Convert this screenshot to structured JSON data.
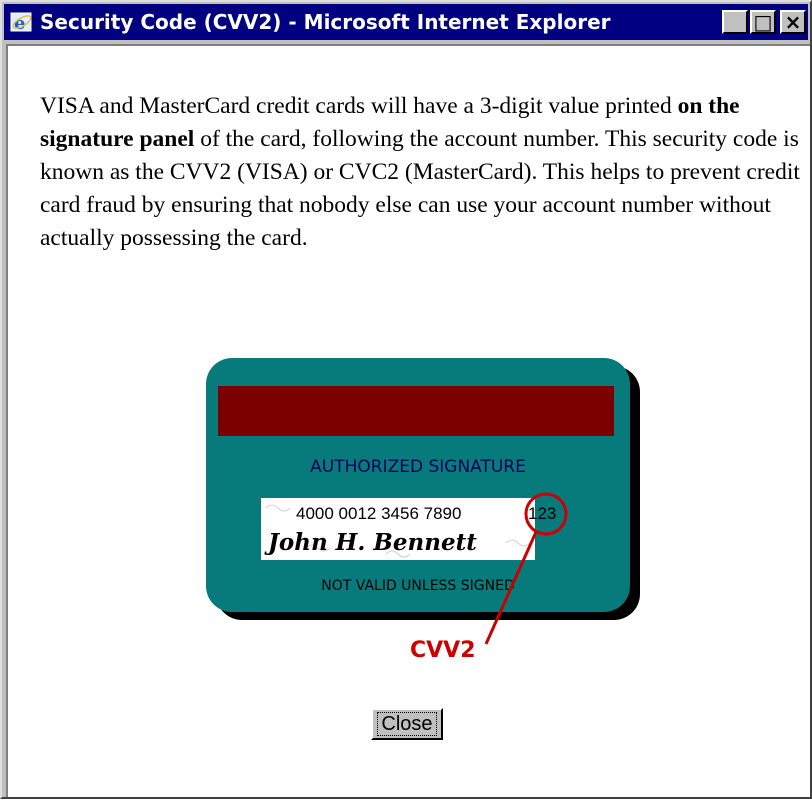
{
  "window": {
    "title": "Security Code (CVV2) - Microsoft Internet Explorer",
    "minimize_glyph": "_",
    "maximize_glyph": "□",
    "close_glyph": "×"
  },
  "content": {
    "para_part1": "VISA and MasterCard credit cards will have a 3-digit value printed ",
    "para_bold": "on the signature panel",
    "para_part2": " of the card, following the account number.  This security code is known as the CVV2 (VISA) or CVC2 (MasterCard).  This helps to prevent credit card fraud by ensuring that nobody else can use your account number without actually possessing the card."
  },
  "card": {
    "authorized_signature": "AUTHORIZED SIGNATURE",
    "account_number": "4000 0012 3456 7890",
    "cvv_digits": "123",
    "signature_name": "John H. Bennett",
    "not_valid": "NOT VALID UNLESS SIGNED",
    "card_color": "#077b7b",
    "stripe_color": "#7b0000",
    "highlight_color": "#cc0000"
  },
  "cvv2_label": "CVV2",
  "close_button": "Close"
}
